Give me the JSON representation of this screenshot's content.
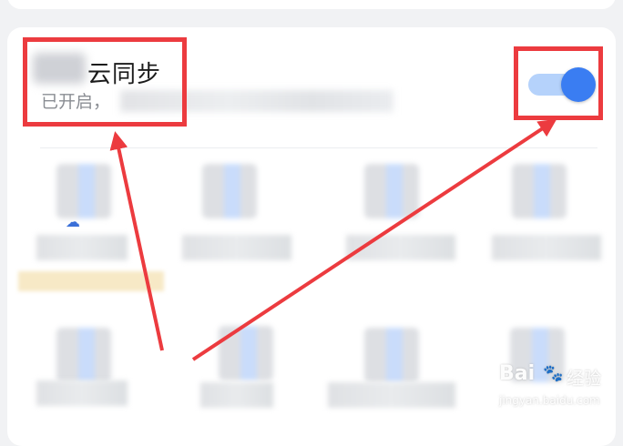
{
  "settings": {
    "title": "云同步",
    "subtitle": "已开启，",
    "toggle_state": "on"
  },
  "partial_text": "☁",
  "watermark": {
    "brand": "Bai",
    "brand_suffix": "经验",
    "url": "jingyan.baidu.com"
  },
  "colors": {
    "accent": "#3a7df2",
    "annotation": "#ec3b3f"
  }
}
